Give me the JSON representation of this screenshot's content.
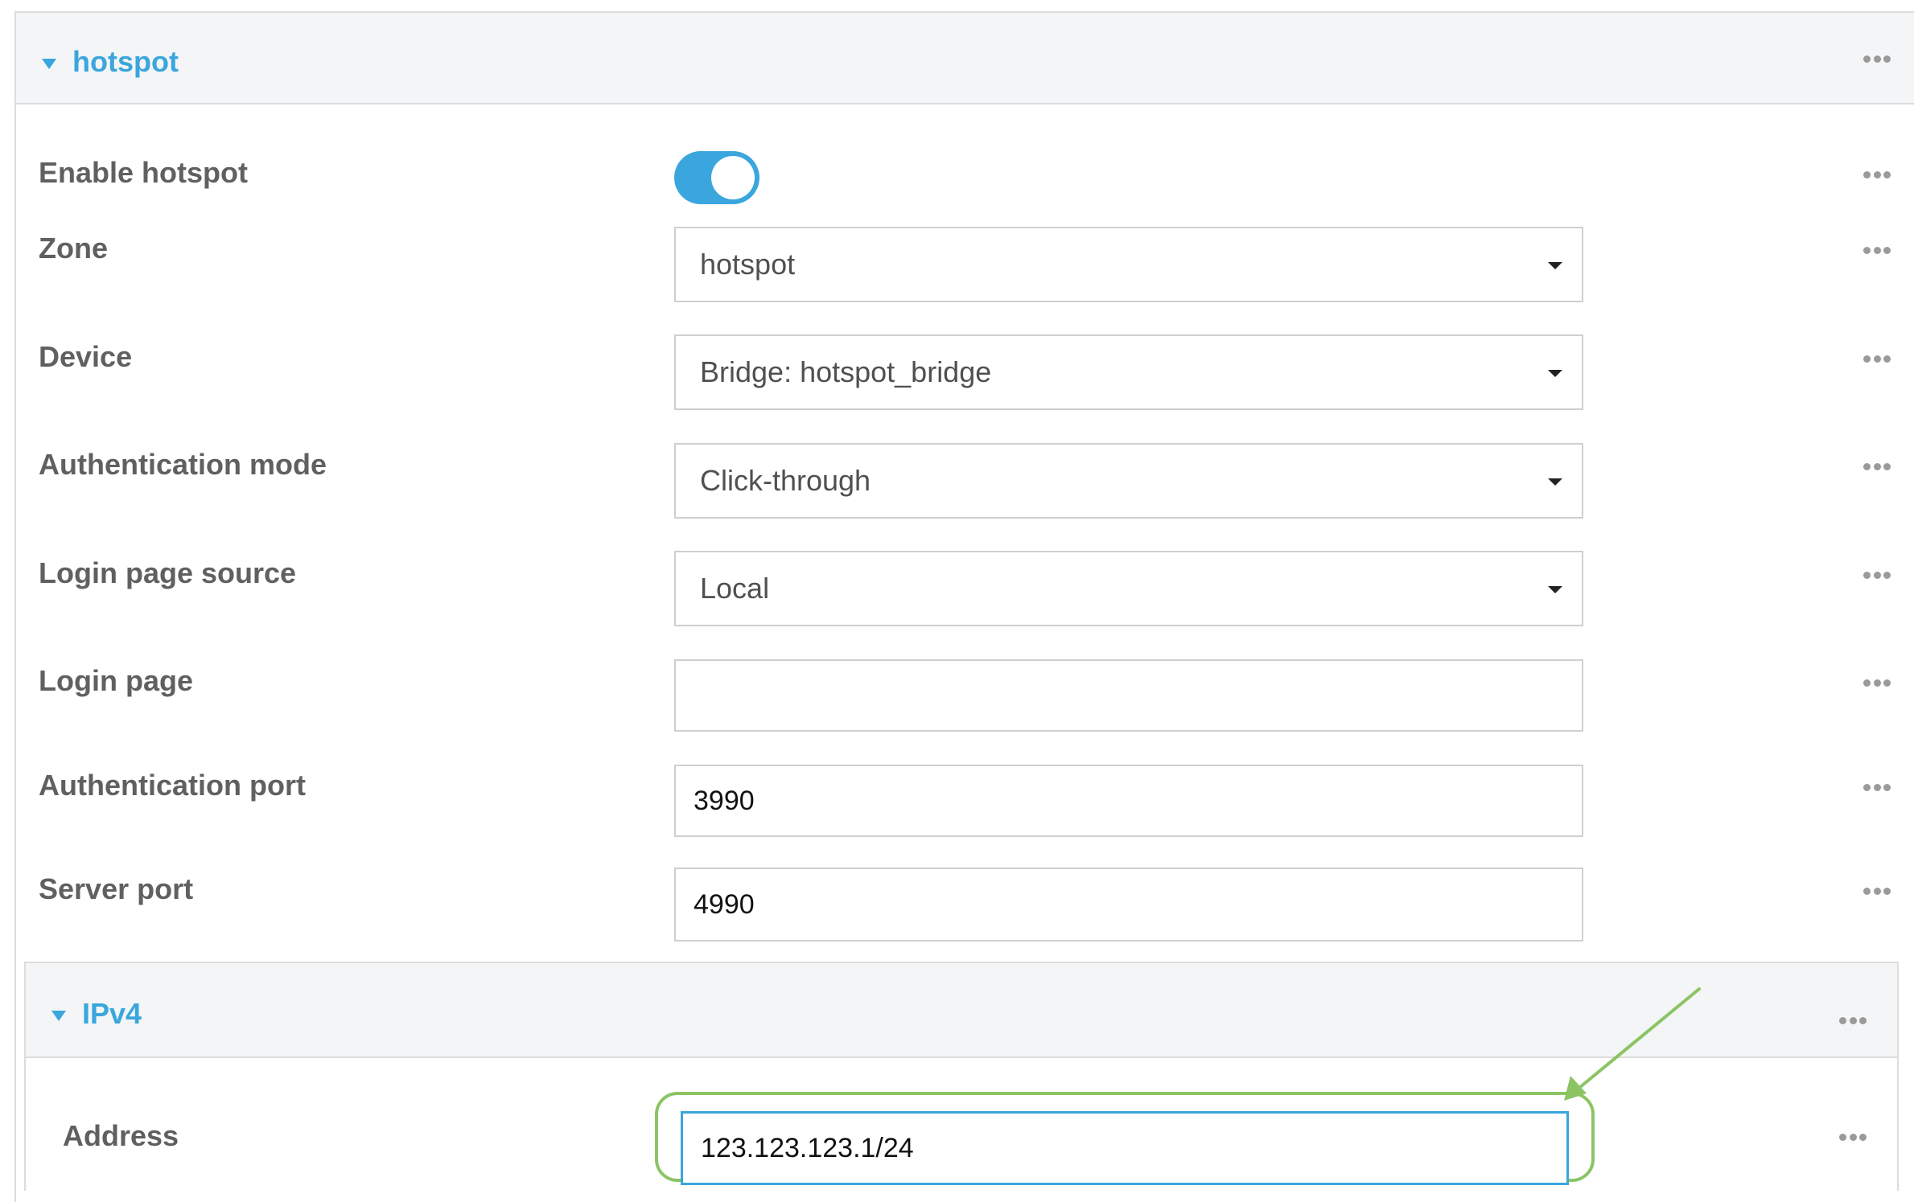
{
  "section": {
    "title": "hotspot"
  },
  "fields": {
    "enable_hotspot": {
      "label": "Enable hotspot",
      "value": "on"
    },
    "zone": {
      "label": "Zone",
      "value": "hotspot"
    },
    "device": {
      "label": "Device",
      "value": "Bridge: hotspot_bridge"
    },
    "auth_mode": {
      "label": "Authentication mode",
      "value": "Click-through"
    },
    "login_source": {
      "label": "Login page source",
      "value": "Local"
    },
    "login_page": {
      "label": "Login page",
      "value": ""
    },
    "auth_port": {
      "label": "Authentication port",
      "value": "3990"
    },
    "server_port": {
      "label": "Server port",
      "value": "4990"
    }
  },
  "ipv4": {
    "title": "IPv4",
    "address": {
      "label": "Address",
      "value": "123.123.123.1/24"
    }
  },
  "colors": {
    "accent": "#3aa6dd",
    "highlight": "#8cc464"
  }
}
